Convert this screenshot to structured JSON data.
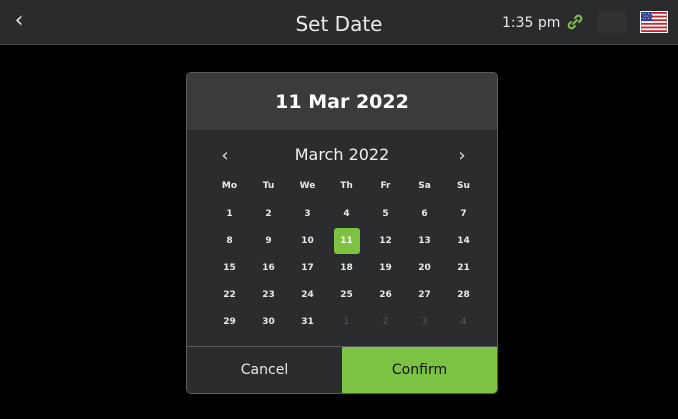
{
  "header": {
    "title": "Set Date",
    "time": "1:35 pm"
  },
  "icons": {
    "back": "chevron-left-icon",
    "link": "link-icon",
    "flag": "us-flag-icon"
  },
  "colors": {
    "accent": "#7dc242",
    "topbar": "#2a2b2c",
    "dialog": "#2b2c2e"
  },
  "dialog": {
    "selected_date": "11 Mar 2022",
    "month_label": "March 2022",
    "weekdays": [
      "Mo",
      "Tu",
      "We",
      "Th",
      "Fr",
      "Sa",
      "Su"
    ],
    "weeks": [
      [
        "1",
        "2",
        "3",
        "4",
        "5",
        "6",
        "7"
      ],
      [
        "8",
        "9",
        "10",
        "11",
        "12",
        "13",
        "14"
      ],
      [
        "15",
        "16",
        "17",
        "18",
        "19",
        "20",
        "21"
      ],
      [
        "22",
        "23",
        "24",
        "25",
        "26",
        "27",
        "28"
      ],
      [
        "29",
        "30",
        "31",
        "1",
        "2",
        "3",
        "4"
      ]
    ],
    "selected_day": "11",
    "cancel_label": "Cancel",
    "confirm_label": "Confirm"
  }
}
